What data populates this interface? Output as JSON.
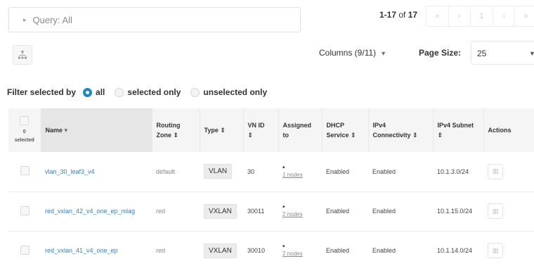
{
  "query": {
    "label": "Query: All"
  },
  "pager": {
    "range": "1-17",
    "of_label": "of",
    "total": "17",
    "buttons": [
      "«",
      "‹",
      "1",
      "›",
      "»"
    ]
  },
  "toolbar": {
    "columns_label": "Columns (9/11)",
    "page_size_label": "Page Size:",
    "page_size_value": "25"
  },
  "filter": {
    "label": "Filter selected by",
    "options": [
      {
        "label": "all",
        "selected": true
      },
      {
        "label": "selected only",
        "selected": false
      },
      {
        "label": "unselected only",
        "selected": false
      }
    ]
  },
  "table": {
    "selected_count": "0 selected",
    "columns": [
      {
        "line1": "Name",
        "line2": ""
      },
      {
        "line1": "Routing",
        "line2": "Zone ⇕"
      },
      {
        "line1": "Type ⇕",
        "line2": ""
      },
      {
        "line1": "VN ID",
        "line2": "⇕"
      },
      {
        "line1": "Assigned",
        "line2": "to"
      },
      {
        "line1": "DHCP",
        "line2": "Service ⇕"
      },
      {
        "line1": "IPv4",
        "line2": "Connectivity ⇕"
      },
      {
        "line1": "IPv4 Subnet",
        "line2": "⇕"
      },
      {
        "line1": "Actions",
        "line2": ""
      }
    ],
    "name_sort_glyph": "▾",
    "rows": [
      {
        "name": "vlan_30_leaf3_v4",
        "routing_zone": "default",
        "type": "VLAN",
        "vn_id": "30",
        "assigned": "1 nodes",
        "dhcp": "Enabled",
        "ipv4": "Enabled",
        "subnet": "10.1.3.0/24"
      },
      {
        "name": "red_vxlan_42_v4_one_ep_mlag",
        "routing_zone": "red",
        "type": "VXLAN",
        "vn_id": "30011",
        "assigned": "2 nodes",
        "dhcp": "Enabled",
        "ipv4": "Enabled",
        "subnet": "10.1.15.0/24"
      },
      {
        "name": "red_vxlan_41_v4_one_ep",
        "routing_zone": "red",
        "type": "VXLAN",
        "vn_id": "30010",
        "assigned": "2 nodes",
        "dhcp": "Enabled",
        "ipv4": "Enabled",
        "subnet": "10.1.14.0/24"
      }
    ]
  },
  "colors": {
    "accent": "#1f86c8",
    "link": "#3a7fb8",
    "header_bg": "#f5f5f5"
  }
}
